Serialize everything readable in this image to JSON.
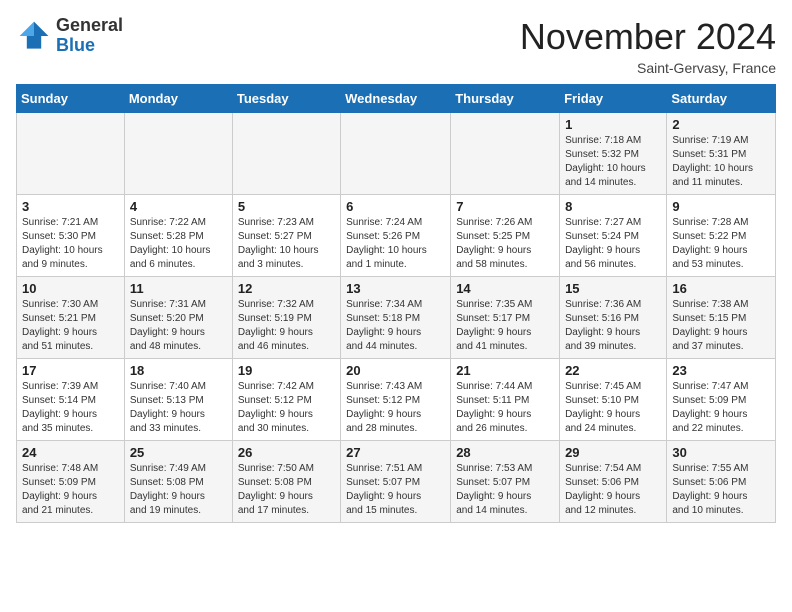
{
  "header": {
    "logo": {
      "line1": "General",
      "line2": "Blue"
    },
    "title": "November 2024",
    "location": "Saint-Gervasy, France"
  },
  "weekdays": [
    "Sunday",
    "Monday",
    "Tuesday",
    "Wednesday",
    "Thursday",
    "Friday",
    "Saturday"
  ],
  "weeks": [
    [
      {
        "day": "",
        "info": ""
      },
      {
        "day": "",
        "info": ""
      },
      {
        "day": "",
        "info": ""
      },
      {
        "day": "",
        "info": ""
      },
      {
        "day": "",
        "info": ""
      },
      {
        "day": "1",
        "info": "Sunrise: 7:18 AM\nSunset: 5:32 PM\nDaylight: 10 hours\nand 14 minutes."
      },
      {
        "day": "2",
        "info": "Sunrise: 7:19 AM\nSunset: 5:31 PM\nDaylight: 10 hours\nand 11 minutes."
      }
    ],
    [
      {
        "day": "3",
        "info": "Sunrise: 7:21 AM\nSunset: 5:30 PM\nDaylight: 10 hours\nand 9 minutes."
      },
      {
        "day": "4",
        "info": "Sunrise: 7:22 AM\nSunset: 5:28 PM\nDaylight: 10 hours\nand 6 minutes."
      },
      {
        "day": "5",
        "info": "Sunrise: 7:23 AM\nSunset: 5:27 PM\nDaylight: 10 hours\nand 3 minutes."
      },
      {
        "day": "6",
        "info": "Sunrise: 7:24 AM\nSunset: 5:26 PM\nDaylight: 10 hours\nand 1 minute."
      },
      {
        "day": "7",
        "info": "Sunrise: 7:26 AM\nSunset: 5:25 PM\nDaylight: 9 hours\nand 58 minutes."
      },
      {
        "day": "8",
        "info": "Sunrise: 7:27 AM\nSunset: 5:24 PM\nDaylight: 9 hours\nand 56 minutes."
      },
      {
        "day": "9",
        "info": "Sunrise: 7:28 AM\nSunset: 5:22 PM\nDaylight: 9 hours\nand 53 minutes."
      }
    ],
    [
      {
        "day": "10",
        "info": "Sunrise: 7:30 AM\nSunset: 5:21 PM\nDaylight: 9 hours\nand 51 minutes."
      },
      {
        "day": "11",
        "info": "Sunrise: 7:31 AM\nSunset: 5:20 PM\nDaylight: 9 hours\nand 48 minutes."
      },
      {
        "day": "12",
        "info": "Sunrise: 7:32 AM\nSunset: 5:19 PM\nDaylight: 9 hours\nand 46 minutes."
      },
      {
        "day": "13",
        "info": "Sunrise: 7:34 AM\nSunset: 5:18 PM\nDaylight: 9 hours\nand 44 minutes."
      },
      {
        "day": "14",
        "info": "Sunrise: 7:35 AM\nSunset: 5:17 PM\nDaylight: 9 hours\nand 41 minutes."
      },
      {
        "day": "15",
        "info": "Sunrise: 7:36 AM\nSunset: 5:16 PM\nDaylight: 9 hours\nand 39 minutes."
      },
      {
        "day": "16",
        "info": "Sunrise: 7:38 AM\nSunset: 5:15 PM\nDaylight: 9 hours\nand 37 minutes."
      }
    ],
    [
      {
        "day": "17",
        "info": "Sunrise: 7:39 AM\nSunset: 5:14 PM\nDaylight: 9 hours\nand 35 minutes."
      },
      {
        "day": "18",
        "info": "Sunrise: 7:40 AM\nSunset: 5:13 PM\nDaylight: 9 hours\nand 33 minutes."
      },
      {
        "day": "19",
        "info": "Sunrise: 7:42 AM\nSunset: 5:12 PM\nDaylight: 9 hours\nand 30 minutes."
      },
      {
        "day": "20",
        "info": "Sunrise: 7:43 AM\nSunset: 5:12 PM\nDaylight: 9 hours\nand 28 minutes."
      },
      {
        "day": "21",
        "info": "Sunrise: 7:44 AM\nSunset: 5:11 PM\nDaylight: 9 hours\nand 26 minutes."
      },
      {
        "day": "22",
        "info": "Sunrise: 7:45 AM\nSunset: 5:10 PM\nDaylight: 9 hours\nand 24 minutes."
      },
      {
        "day": "23",
        "info": "Sunrise: 7:47 AM\nSunset: 5:09 PM\nDaylight: 9 hours\nand 22 minutes."
      }
    ],
    [
      {
        "day": "24",
        "info": "Sunrise: 7:48 AM\nSunset: 5:09 PM\nDaylight: 9 hours\nand 21 minutes."
      },
      {
        "day": "25",
        "info": "Sunrise: 7:49 AM\nSunset: 5:08 PM\nDaylight: 9 hours\nand 19 minutes."
      },
      {
        "day": "26",
        "info": "Sunrise: 7:50 AM\nSunset: 5:08 PM\nDaylight: 9 hours\nand 17 minutes."
      },
      {
        "day": "27",
        "info": "Sunrise: 7:51 AM\nSunset: 5:07 PM\nDaylight: 9 hours\nand 15 minutes."
      },
      {
        "day": "28",
        "info": "Sunrise: 7:53 AM\nSunset: 5:07 PM\nDaylight: 9 hours\nand 14 minutes."
      },
      {
        "day": "29",
        "info": "Sunrise: 7:54 AM\nSunset: 5:06 PM\nDaylight: 9 hours\nand 12 minutes."
      },
      {
        "day": "30",
        "info": "Sunrise: 7:55 AM\nSunset: 5:06 PM\nDaylight: 9 hours\nand 10 minutes."
      }
    ]
  ]
}
